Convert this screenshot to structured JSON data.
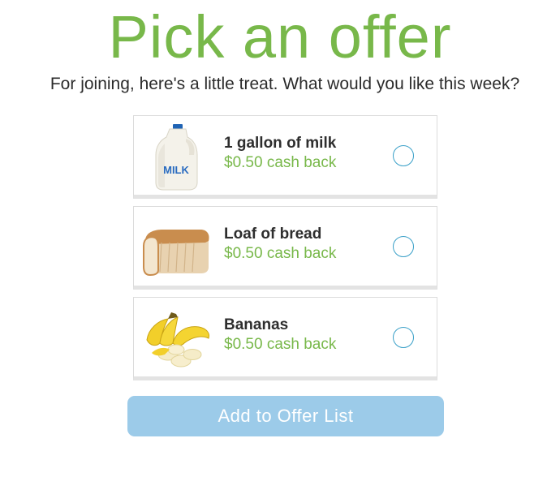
{
  "header": {
    "title": "Pick an offer",
    "subtitle": "For joining, here's a little treat. What would you like this week?"
  },
  "offers": [
    {
      "name": "1 gallon of milk",
      "value": "$0.50 cash back",
      "image_label": "MILK",
      "icon": "milk-jug-icon",
      "selected": false
    },
    {
      "name": "Loaf of bread",
      "value": "$0.50 cash back",
      "icon": "bread-loaf-icon",
      "selected": false
    },
    {
      "name": "Bananas",
      "value": "$0.50 cash back",
      "icon": "bananas-icon",
      "selected": false
    }
  ],
  "actions": {
    "add_label": "Add to Offer List"
  },
  "colors": {
    "accent_green": "#78b84a",
    "radio_blue": "#3aa0c8",
    "button_disabled_blue": "#9ccbe9"
  }
}
